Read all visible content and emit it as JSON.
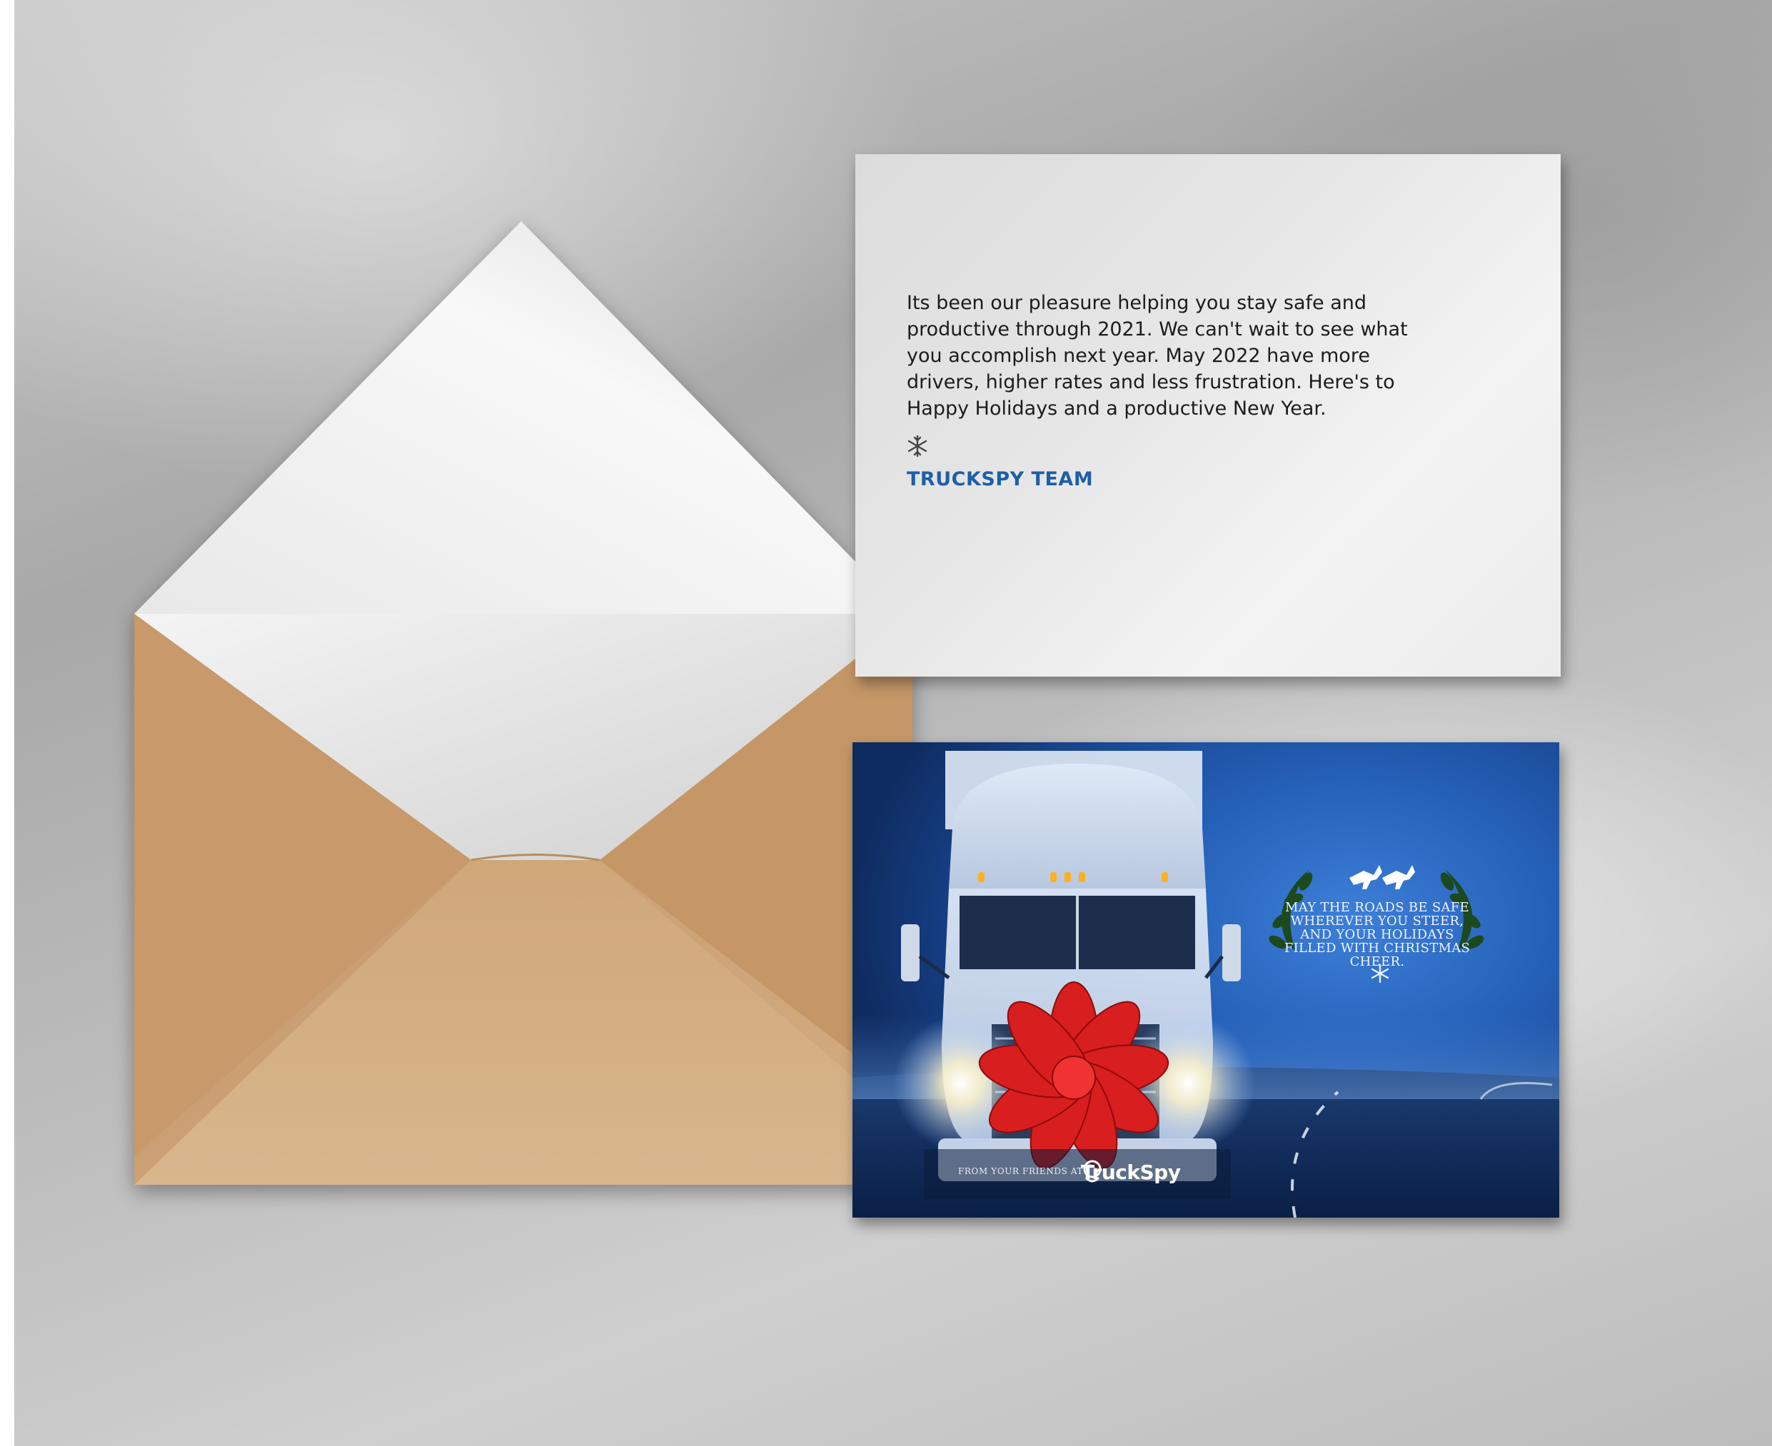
{
  "message_card": {
    "body": "Its been our pleasure helping you stay safe and productive through 2021. We can't wait to see what you accomplish next year. May 2022 have more drivers, higher rates and less frustration. Here's to Happy Holidays and a productive New Year.",
    "signature": "TRUCKSPY TEAM",
    "icon": "snowflake-icon"
  },
  "photo_card": {
    "greeting": "MAY THE ROADS BE SAFE WHEREVER YOU STEER, AND YOUR HOLIDAYS FILLED WITH CHRISTMAS CHEER.",
    "from_line": "FROM YOUR FRIENDS AT",
    "brand_name": "TruckSpy",
    "icons": [
      "truck-illustration",
      "red-bow-icon",
      "reindeer-icon",
      "holly-branch-icon",
      "snowflake-icon",
      "truckspy-logo-icon"
    ]
  },
  "colors": {
    "signature_blue": "#1e5fa6",
    "card_blue": "#2560b8",
    "envelope_kraft": "#c9a47a",
    "bow_red": "#d81e1e"
  }
}
